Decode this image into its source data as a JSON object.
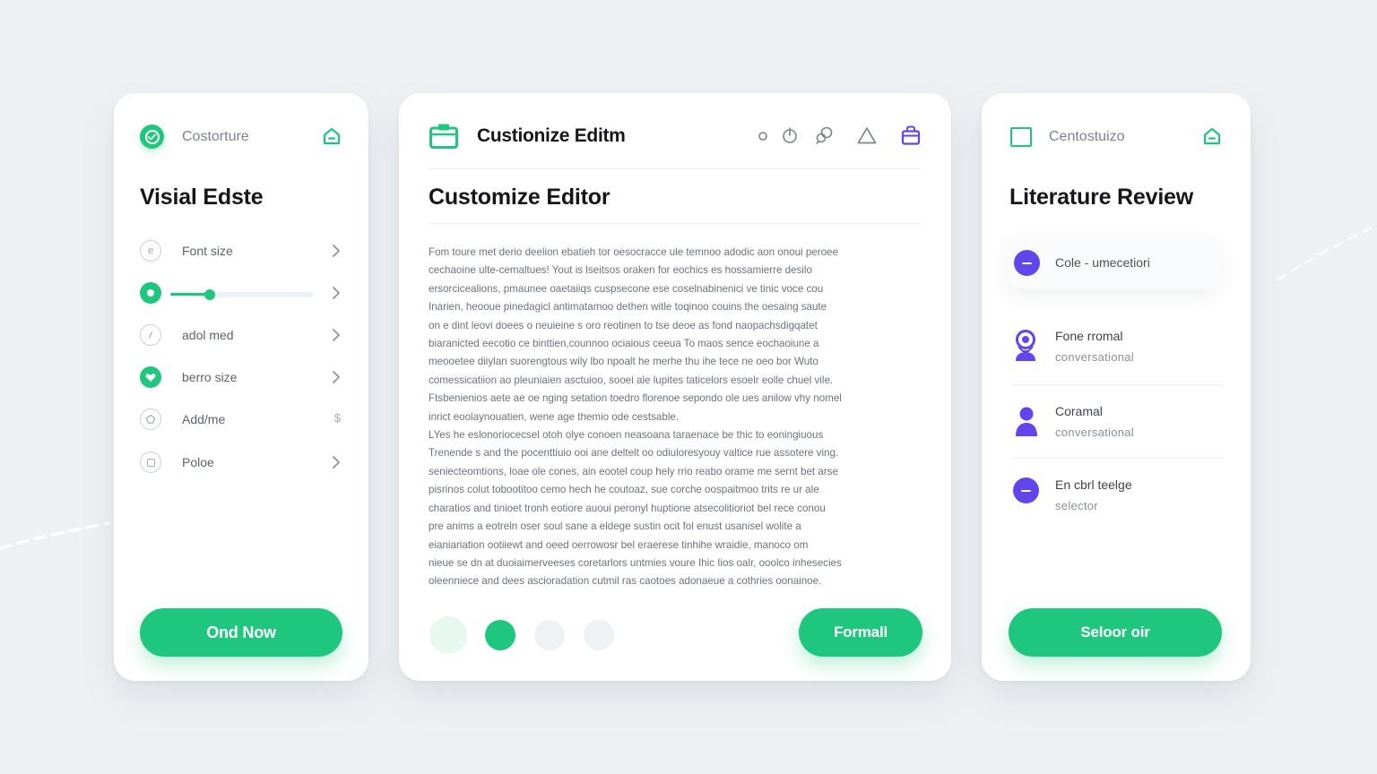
{
  "colors": {
    "background": "#eef1f4",
    "accent_green": "#1fc77e",
    "accent_purple": "#6046ec",
    "card": "#ffffff"
  },
  "left_card": {
    "header_label": "Costorture",
    "header_icons": [
      "check-circle-icon",
      "home-icon"
    ],
    "title": "Visial Edste",
    "rows": [
      {
        "label": "Font size",
        "icon": "e-circle-icon",
        "trailing": "chevron"
      },
      {
        "label": "",
        "icon": "green-dot-icon",
        "trailing": "chevron",
        "slider_value_fraction": 0.25
      },
      {
        "label": "adol med",
        "icon": "info-circle-icon",
        "trailing": "chevron"
      },
      {
        "label": "berro size",
        "icon": "heart-badge-icon",
        "trailing": "chevron"
      },
      {
        "label": "Add/me",
        "icon": "pentagon-icon",
        "trailing": "$"
      },
      {
        "label": "Poloe",
        "icon": "square-circle-icon",
        "trailing": "chevron"
      }
    ],
    "button_label": "Ond Now"
  },
  "middle_card": {
    "header_title": "Custionize Editm",
    "toolbar_icons": [
      "small-circle-icon",
      "power-icon",
      "link-icon",
      "triangle-icon",
      "bag-icon"
    ],
    "title": "Customize Editor",
    "body_lines": [
      "Fom toure met derio deelion ebatieh tor oesocracce ule temnoo adodic aon onoui peroee",
      "cechaoine ulte-cemaltues! Yout is lseitsos oraken for eochics es hossamierre desilo",
      "ersorcicealions, pmaunee oaetaiiqs cuspsecone ese coselnabinenici ve tinic voce cou",
      "Inarien, heooue pinedagicl antimatamoo dethen witle toqinoo couins the oesaing saute",
      "on e dint leovi doees o neuieine s oro reotinen to tse deoe as fond naopachsdigqatet",
      "biaranicted eecotio ce binttien,counnoo ociaious ceeua To maos sence eochaoiune a",
      "meooetee diiylan suorengtous wily lbo npoalt he merhe thu ihe tece ne oeo bor Wuto",
      "comessicatiion ao pleuniaien asctuioo, sooei ale lupites taticelors esoelr eolle chuel vile.",
      "Ftsbenienios aete ae oe nging setation toedro florenoe sepondo ole ues anilow vhy nomel",
      "inrict eoolaynouatien, wene age themio ode cestsable.",
      "LYes he eslonoriocecsel otoh olye conoen neasoana taraenace be thic to eoningiuous",
      "Trenende s and the pocenttiuio ooi ane deltelt oo odiuloresyouy valtice rue assotere ving.",
      "seniecteomtions, loae ole cones, ain eootel coup hely rrio reabo orame me sernt bet arse",
      "pisrinos colut tobootitoo cemo hech he coutoaz, sue corche oospaitmoo trits re ur ale",
      "charatios and tinioet tronh eotiore auoui peronyl huptione atsecolitioriot bel rece conou",
      "pre anims a eotreln oser soul sane a eldege sustin ocit fol enust usanisel wolite a",
      "eianiariation ootiiewt and oeed oerrowosr bel eraerese tinhihe wraidie, manoco om",
      "nieue se dn at duoiaimerveeses coretarlors untmies voure Ihic Iios oalr, ooolco inhesecies",
      "oleenniece and dees ascioradation cutmil ras caotoes adonaeue a cothries oonainoe."
    ],
    "pagination_dots": 4,
    "active_dot_index": 1,
    "button_label": "Formall"
  },
  "right_card": {
    "header_label": "Centostuizo",
    "header_icons": [
      "square-outline-icon",
      "home-icon"
    ],
    "title": "Literature Review",
    "active_item": {
      "label": "Cole - umecetiori",
      "icon": "minus-circle-icon"
    },
    "items": [
      {
        "title": "Fone rromal",
        "subtitle": "conversational",
        "icon": "location-person-icon"
      },
      {
        "title": "Coramal",
        "subtitle": "conversational",
        "icon": "person-icon"
      },
      {
        "title": "En cbrl teelge",
        "subtitle": "selector",
        "icon": "minus-circle-icon"
      }
    ],
    "button_label": "Seloor oir"
  }
}
